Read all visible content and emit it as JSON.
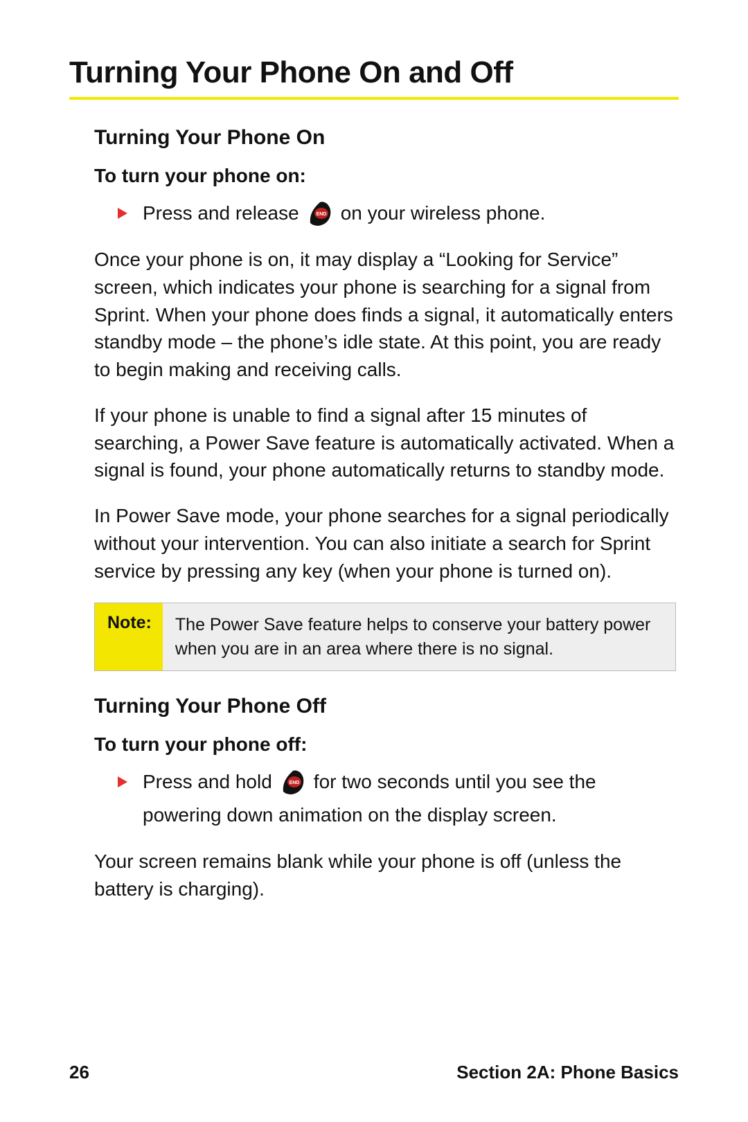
{
  "title": "Turning Your Phone On and Off",
  "on": {
    "heading": "Turning Your Phone On",
    "instruction": "To turn your phone on:",
    "bullet_pre": "Press and release",
    "bullet_post": "on your wireless phone.",
    "p1": "Once your phone is on, it may display a “Looking for Service” screen, which indicates your phone is searching for a signal from Sprint. When your phone does finds a signal, it automatically enters standby mode – the phone’s idle state. At this point, you are ready to begin making and receiving calls.",
    "p2": "If your phone is unable to find a signal after 15 minutes of searching, a Power Save feature is automatically activated. When a signal is found, your phone automatically returns to standby mode.",
    "p3": "In Power Save mode, your phone searches for a signal periodically without your intervention. You can also initiate a search for Sprint service by pressing any key (when your phone is turned on)."
  },
  "note": {
    "label": "Note:",
    "body": "The Power Save feature helps to conserve your battery power when you are in an area where there is no signal."
  },
  "off": {
    "heading": "Turning Your Phone Off",
    "instruction": "To turn your phone off:",
    "bullet_pre": "Press and hold",
    "bullet_post": "for two seconds until you see the",
    "bullet_cont": "powering down animation on the display screen.",
    "p1": "Your screen remains blank while your phone is off (unless the battery is charging)."
  },
  "footer": {
    "page": "26",
    "section": "Section 2A: Phone Basics"
  },
  "icons": {
    "end_key": "end-key-icon"
  }
}
